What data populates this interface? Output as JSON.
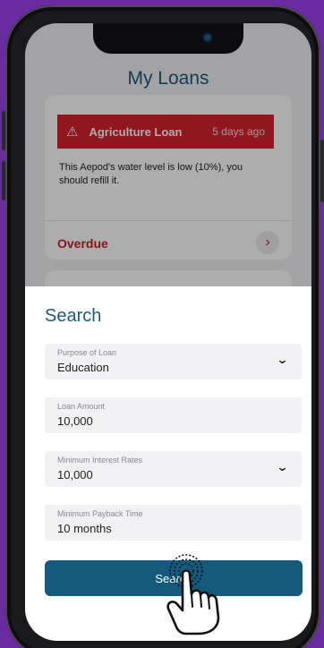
{
  "page": {
    "title": "My Loans"
  },
  "loan_card": {
    "warning_icon": "warning-icon",
    "title": "Agriculture Loan",
    "time": "5 days ago",
    "message": "This Aepod's water level is low (10%), you should refill it.",
    "status": "Overdue",
    "chevron_icon": "chevron-right-icon"
  },
  "search_sheet": {
    "title": "Search",
    "fields": [
      {
        "label": "Purpose of Loan",
        "value": "Education",
        "dropdown": true
      },
      {
        "label": "Loan Amount",
        "value": "10,000",
        "dropdown": false
      },
      {
        "label": "Minimum Interest Rates",
        "value": "10,000",
        "dropdown": true
      },
      {
        "label": "Minimum Payback Time",
        "value": "10 months",
        "dropdown": false
      }
    ],
    "button_label": "Search"
  },
  "colors": {
    "background": "#6a2aa0",
    "accent": "#135a7d",
    "alert": "#d4212e"
  }
}
